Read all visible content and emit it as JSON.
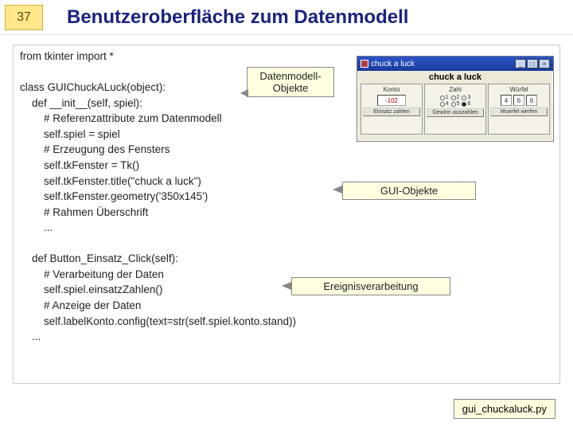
{
  "slide": {
    "number": "37",
    "title": "Benutzeroberfläche zum Datenmodell"
  },
  "code": {
    "line01": "from tkinter import *",
    "line02": "",
    "line03": "class GUIChuckALuck(object):",
    "line04": "    def __init__(self, spiel):",
    "line05": "        # Referenzattribute zum Datenmodell",
    "line06": "        self.spiel = spiel",
    "line07": "        # Erzeugung des Fensters",
    "line08": "        self.tkFenster = Tk()",
    "line09": "        self.tkFenster.title(\"chuck a luck\")",
    "line10": "        self.tkFenster.geometry('350x145')",
    "line11": "        # Rahmen Überschrift",
    "line12": "        ...",
    "line13": "",
    "line14": "    def Button_Einsatz_Click(self):",
    "line15": "        # Verarbeitung der Daten",
    "line16": "        self.spiel.einsatzZahlen()",
    "line17": "        # Anzeige der Daten",
    "line18": "        self.labelKonto.config(text=str(self.spiel.konto.stand))",
    "line19": "    ...",
    "line20": ""
  },
  "callouts": {
    "datamodel": "Datenmodell-\nObjekte",
    "gui": "GUI-Objekte",
    "event": "Ereignisverarbeitung"
  },
  "window": {
    "titlebar": "chuck a luck",
    "app_title": "chuck a luck",
    "panels": {
      "konto": {
        "title": "Konto",
        "value": "-102",
        "btn": "Einsatz zahlen"
      },
      "zahl": {
        "title": "Zahl",
        "r1": "1",
        "r2": "2",
        "r3": "3",
        "r4": "4",
        "r5": "5",
        "r6": "6",
        "btn": "Gewinn auszahlen"
      },
      "wuerfel": {
        "title": "Würfel",
        "d1": "4",
        "d2": "6",
        "d3": "6",
        "btn": "Wuerfel werfen"
      }
    }
  },
  "filename": "gui_chuckaluck.py"
}
